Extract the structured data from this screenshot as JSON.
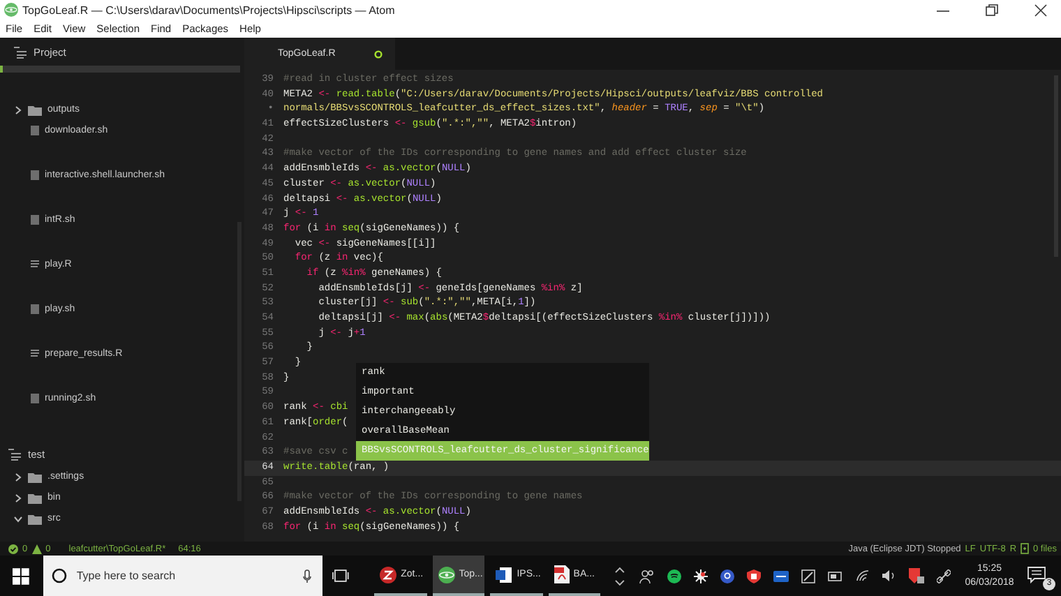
{
  "window": {
    "title": "TopGoLeaf.R — C:\\Users\\darav\\Documents\\Projects\\Hipsci\\scripts — Atom"
  },
  "menu": [
    "File",
    "Edit",
    "View",
    "Selection",
    "Find",
    "Packages",
    "Help"
  ],
  "sidebar": {
    "title": "Project",
    "items": [
      {
        "name": "outputs",
        "kind": "folder",
        "expanded": false
      },
      {
        "name": "downloader.sh",
        "kind": "shell"
      },
      {
        "name": "interactive.shell.launcher.sh",
        "kind": "shell"
      },
      {
        "name": "intR.sh",
        "kind": "shell"
      },
      {
        "name": "play.R",
        "kind": "r"
      },
      {
        "name": "play.sh",
        "kind": "shell"
      },
      {
        "name": "prepare_results.R",
        "kind": "r"
      },
      {
        "name": "running2.sh",
        "kind": "shell"
      }
    ],
    "project": {
      "name": "test",
      "items": [
        {
          "name": ".settings",
          "kind": "folder",
          "expanded": false
        },
        {
          "name": "bin",
          "kind": "folder",
          "expanded": false
        },
        {
          "name": "src",
          "kind": "folder",
          "expanded": true
        }
      ]
    }
  },
  "tab": {
    "label": "TopGoLeaf.R",
    "modified": true
  },
  "code": [
    {
      "num": "39",
      "tokens": [
        {
          "text": "#read in cluster effect sizes",
          "kind": "comment"
        }
      ]
    },
    {
      "num": "40",
      "tokens": [
        {
          "text": "META2 ",
          "kind": "plain"
        },
        {
          "text": "<-",
          "kind": "operator"
        },
        {
          "text": " read.table",
          "kind": "function"
        },
        {
          "text": "(",
          "kind": "plain"
        },
        {
          "text": "\"C:/Users/darav/Documents/Projects/Hipsci/outputs/leafviz/BBS controlled",
          "kind": "string"
        }
      ]
    },
    {
      "num": "•",
      "tokens": [
        {
          "text": "normals/BBSvsSCONTROLS_leafcutter_ds_effect_sizes.txt\"",
          "kind": "string"
        },
        {
          "text": ", ",
          "kind": "plain"
        },
        {
          "text": "header",
          "kind": "argument"
        },
        {
          "text": " = ",
          "kind": "plain"
        },
        {
          "text": "TRUE",
          "kind": "constant"
        },
        {
          "text": ", ",
          "kind": "plain"
        },
        {
          "text": "sep",
          "kind": "argument"
        },
        {
          "text": " = ",
          "kind": "plain"
        },
        {
          "text": "\"\\t\"",
          "kind": "string"
        },
        {
          "text": ")",
          "kind": "plain"
        }
      ]
    },
    {
      "num": "41",
      "tokens": [
        {
          "text": "effectSizeClusters ",
          "kind": "plain"
        },
        {
          "text": "<-",
          "kind": "operator"
        },
        {
          "text": " gsub",
          "kind": "function"
        },
        {
          "text": "(",
          "kind": "plain"
        },
        {
          "text": "\".*:\",\"\"",
          "kind": "string"
        },
        {
          "text": ", META2",
          "kind": "plain"
        },
        {
          "text": "$",
          "kind": "operator"
        },
        {
          "text": "intron)",
          "kind": "plain"
        }
      ]
    },
    {
      "num": "42"
    },
    {
      "num": "43",
      "tokens": [
        {
          "text": "#make vector of the IDs corresponding to gene names and add effect cluster size",
          "kind": "comment"
        }
      ]
    },
    {
      "num": "44",
      "tokens": [
        {
          "text": "addEnsmbleIds ",
          "kind": "plain"
        },
        {
          "text": "<-",
          "kind": "operator"
        },
        {
          "text": " as.vector",
          "kind": "function"
        },
        {
          "text": "(",
          "kind": "plain"
        },
        {
          "text": "NULL",
          "kind": "constant"
        },
        {
          "text": ")",
          "kind": "plain"
        }
      ]
    },
    {
      "num": "45",
      "tokens": [
        {
          "text": "cluster ",
          "kind": "plain"
        },
        {
          "text": "<-",
          "kind": "operator"
        },
        {
          "text": " as.vector",
          "kind": "function"
        },
        {
          "text": "(",
          "kind": "plain"
        },
        {
          "text": "NULL",
          "kind": "constant"
        },
        {
          "text": ")",
          "kind": "plain"
        }
      ]
    },
    {
      "num": "46",
      "tokens": [
        {
          "text": "deltapsi ",
          "kind": "plain"
        },
        {
          "text": "<-",
          "kind": "operator"
        },
        {
          "text": " as.vector",
          "kind": "function"
        },
        {
          "text": "(",
          "kind": "plain"
        },
        {
          "text": "NULL",
          "kind": "constant"
        },
        {
          "text": ")",
          "kind": "plain"
        }
      ]
    },
    {
      "num": "47",
      "tokens": [
        {
          "text": "j ",
          "kind": "plain"
        },
        {
          "text": "<-",
          "kind": "operator"
        },
        {
          "text": " 1",
          "kind": "constant"
        }
      ]
    },
    {
      "num": "48",
      "tokens": [
        {
          "text": "for",
          "kind": "keyword"
        },
        {
          "text": " (i ",
          "kind": "plain"
        },
        {
          "text": "in",
          "kind": "keyword"
        },
        {
          "text": " seq",
          "kind": "function"
        },
        {
          "text": "(sigGeneNames)) {",
          "kind": "plain"
        }
      ]
    },
    {
      "num": "49",
      "tokens": [
        {
          "text": "  vec ",
          "kind": "plain"
        },
        {
          "text": "<-",
          "kind": "operator"
        },
        {
          "text": " sigGeneNames[[i]]",
          "kind": "plain"
        }
      ]
    },
    {
      "num": "50",
      "tokens": [
        {
          "text": "  for",
          "kind": "keyword"
        },
        {
          "text": " (z ",
          "kind": "plain"
        },
        {
          "text": "in",
          "kind": "keyword"
        },
        {
          "text": " vec){",
          "kind": "plain"
        }
      ]
    },
    {
      "num": "51",
      "tokens": [
        {
          "text": "    if",
          "kind": "keyword"
        },
        {
          "text": " (z ",
          "kind": "plain"
        },
        {
          "text": "%in%",
          "kind": "operator"
        },
        {
          "text": " geneNames) {",
          "kind": "plain"
        }
      ]
    },
    {
      "num": "52",
      "tokens": [
        {
          "text": "      addEnsmbleIds[j] ",
          "kind": "plain"
        },
        {
          "text": "<-",
          "kind": "operator"
        },
        {
          "text": " geneIds[geneNames ",
          "kind": "plain"
        },
        {
          "text": "%in%",
          "kind": "operator"
        },
        {
          "text": " z]",
          "kind": "plain"
        }
      ]
    },
    {
      "num": "53",
      "tokens": [
        {
          "text": "      cluster[j] ",
          "kind": "plain"
        },
        {
          "text": "<-",
          "kind": "operator"
        },
        {
          "text": " sub",
          "kind": "function"
        },
        {
          "text": "(",
          "kind": "plain"
        },
        {
          "text": "\".*:\",\"\"",
          "kind": "string"
        },
        {
          "text": ",META[i,",
          "kind": "plain"
        },
        {
          "text": "1",
          "kind": "constant"
        },
        {
          "text": "])",
          "kind": "plain"
        }
      ]
    },
    {
      "num": "54",
      "tokens": [
        {
          "text": "      deltapsi[j] ",
          "kind": "plain"
        },
        {
          "text": "<-",
          "kind": "operator"
        },
        {
          "text": " max",
          "kind": "function"
        },
        {
          "text": "(",
          "kind": "plain"
        },
        {
          "text": "abs",
          "kind": "function"
        },
        {
          "text": "(META2",
          "kind": "plain"
        },
        {
          "text": "$",
          "kind": "operator"
        },
        {
          "text": "deltapsi[(effectSizeClusters ",
          "kind": "plain"
        },
        {
          "text": "%in%",
          "kind": "operator"
        },
        {
          "text": " cluster[j])]))",
          "kind": "plain"
        }
      ]
    },
    {
      "num": "55",
      "tokens": [
        {
          "text": "      j ",
          "kind": "plain"
        },
        {
          "text": "<-",
          "kind": "operator"
        },
        {
          "text": " j",
          "kind": "plain"
        },
        {
          "text": "+",
          "kind": "operator"
        },
        {
          "text": "1",
          "kind": "constant"
        }
      ]
    },
    {
      "num": "56",
      "tokens": [
        {
          "text": "    }",
          "kind": "plain"
        }
      ]
    },
    {
      "num": "57",
      "tokens": [
        {
          "text": "  }",
          "kind": "plain"
        }
      ]
    },
    {
      "num": "58",
      "tokens": [
        {
          "text": "}",
          "kind": "plain"
        }
      ]
    },
    {
      "num": "59"
    },
    {
      "num": "60",
      "tokens": [
        {
          "text": "rank ",
          "kind": "plain"
        },
        {
          "text": "<-",
          "kind": "operator"
        },
        {
          "text": " cbi",
          "kind": "function"
        }
      ]
    },
    {
      "num": "61",
      "tokens": [
        {
          "text": "rank[",
          "kind": "plain"
        },
        {
          "text": "order",
          "kind": "function"
        },
        {
          "text": "(",
          "kind": "plain"
        }
      ]
    },
    {
      "num": "62"
    },
    {
      "num": "63",
      "tokens": [
        {
          "text": "#save csv c",
          "kind": "comment"
        }
      ]
    },
    {
      "num": "64",
      "current": true,
      "tokens": [
        {
          "text": "write.table",
          "kind": "function"
        },
        {
          "text": "(ran, )",
          "kind": "plain"
        }
      ]
    },
    {
      "num": "65"
    },
    {
      "num": "66",
      "tokens": [
        {
          "text": "#make vector of the IDs corresponding to gene names",
          "kind": "comment"
        }
      ]
    },
    {
      "num": "67",
      "tokens": [
        {
          "text": "addEnsmbleIds ",
          "kind": "plain"
        },
        {
          "text": "<-",
          "kind": "operator"
        },
        {
          "text": " as.vector",
          "kind": "function"
        },
        {
          "text": "(",
          "kind": "plain"
        },
        {
          "text": "NULL",
          "kind": "constant"
        },
        {
          "text": ")",
          "kind": "plain"
        }
      ]
    },
    {
      "num": "68",
      "tokens": [
        {
          "text": "for",
          "kind": "keyword"
        },
        {
          "text": " (i ",
          "kind": "plain"
        },
        {
          "text": "in",
          "kind": "keyword"
        },
        {
          "text": " seq",
          "kind": "function"
        },
        {
          "text": "(sigGeneNames)) {",
          "kind": "plain"
        }
      ]
    }
  ],
  "autocomplete": [
    {
      "label": "rank",
      "selected": false
    },
    {
      "label": "important",
      "selected": false
    },
    {
      "label": "interchangeeably",
      "selected": false
    },
    {
      "label": "overallBaseMean",
      "selected": false
    },
    {
      "label": "BBSvsSCONTROLS_leafcutter_ds_cluster_significance",
      "selected": true
    }
  ],
  "status_bar": {
    "errors": "0",
    "warnings": "0",
    "file": "leafcutter\\TopGoLeaf.R*",
    "position": "64:16",
    "grammar_status": "Java (Eclipse JDT) Stopped",
    "line_ending": "LF",
    "encoding": "UTF-8",
    "grammar": "R",
    "files": "0 files"
  },
  "taskbar": {
    "search_placeholder": "Type here to search",
    "apps": [
      {
        "label": "Zot...",
        "kind": "zotero",
        "selected": false
      },
      {
        "label": "Top...",
        "kind": "atom",
        "selected": true
      },
      {
        "label": "IPS...",
        "kind": "word",
        "selected": false
      },
      {
        "label": "BA...",
        "kind": "pdf",
        "selected": false
      }
    ],
    "time": "15:25",
    "date": "06/03/2018",
    "notifications": "3"
  }
}
